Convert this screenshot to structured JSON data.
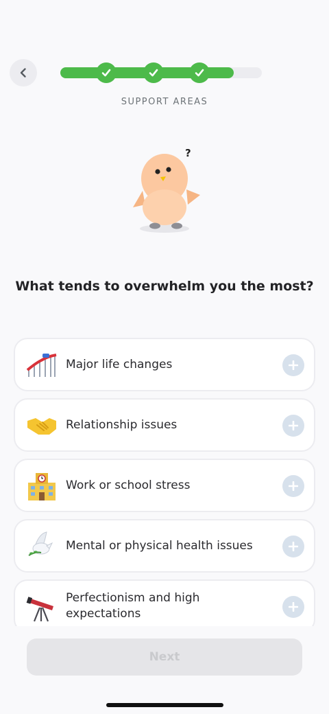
{
  "header": {
    "back_icon": "chevron-left-icon",
    "progress": {
      "completed_steps": 3,
      "total_steps": 4,
      "fill_fraction": 0.86
    },
    "section_label": "SUPPORT AREAS"
  },
  "mascot": {
    "thought_mark": "?"
  },
  "question": "What tends to overwhelm you the most?",
  "options": [
    {
      "label": "Major life changes",
      "icon": "roller-coaster-icon"
    },
    {
      "label": "Relationship issues",
      "icon": "handshake-icon"
    },
    {
      "label": "Work or school stress",
      "icon": "school-building-icon"
    },
    {
      "label": "Mental or physical health issues",
      "icon": "dove-icon"
    },
    {
      "label": "Perfectionism and high expectations",
      "icon": "telescope-icon"
    }
  ],
  "next_label": "Next",
  "colors": {
    "accent_green": "#4dba4a",
    "plus_bg": "#d7e1ec",
    "disabled_button": "#e5e5e8"
  }
}
